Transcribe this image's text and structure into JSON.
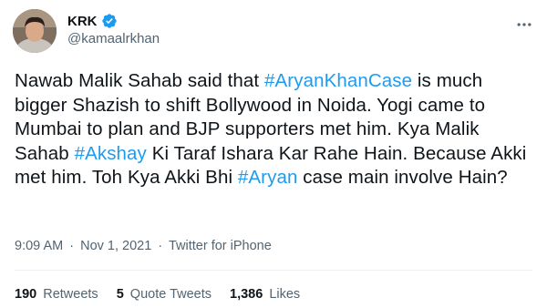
{
  "author": {
    "display_name": "KRK",
    "handle": "@kamaalrkhan",
    "verified": true
  },
  "colors": {
    "link": "#1d9bf0",
    "secondary_text": "#536471",
    "primary_text": "#0f1419"
  },
  "icons": {
    "verified": "verified-badge-icon",
    "more": "more-horizontal-icon"
  },
  "tweet": {
    "segments": [
      {
        "text": "Nawab Malik Sahab said that ",
        "hashtag": false
      },
      {
        "text": "#AryanKhanCase",
        "hashtag": true
      },
      {
        "text": " is much bigger Shazish to shift Bollywood in Noida. Yogi came to Mumbai to plan and BJP supporters met him. Kya Malik Sahab ",
        "hashtag": false
      },
      {
        "text": "#Akshay",
        "hashtag": true
      },
      {
        "text": " Ki Taraf Ishara Kar Rahe Hain. Because Akki met him. Toh Kya Akki Bhi ",
        "hashtag": false
      },
      {
        "text": "#Aryan",
        "hashtag": true
      },
      {
        "text": " case main involve Hain?",
        "hashtag": false
      }
    ]
  },
  "meta": {
    "time": "9:09 AM",
    "separator": "·",
    "date": "Nov 1, 2021",
    "source": "Twitter for iPhone"
  },
  "stats": {
    "retweets": {
      "count": "190",
      "label": "Retweets"
    },
    "quote_tweets": {
      "count": "5",
      "label": "Quote Tweets"
    },
    "likes": {
      "count": "1,386",
      "label": "Likes"
    }
  }
}
